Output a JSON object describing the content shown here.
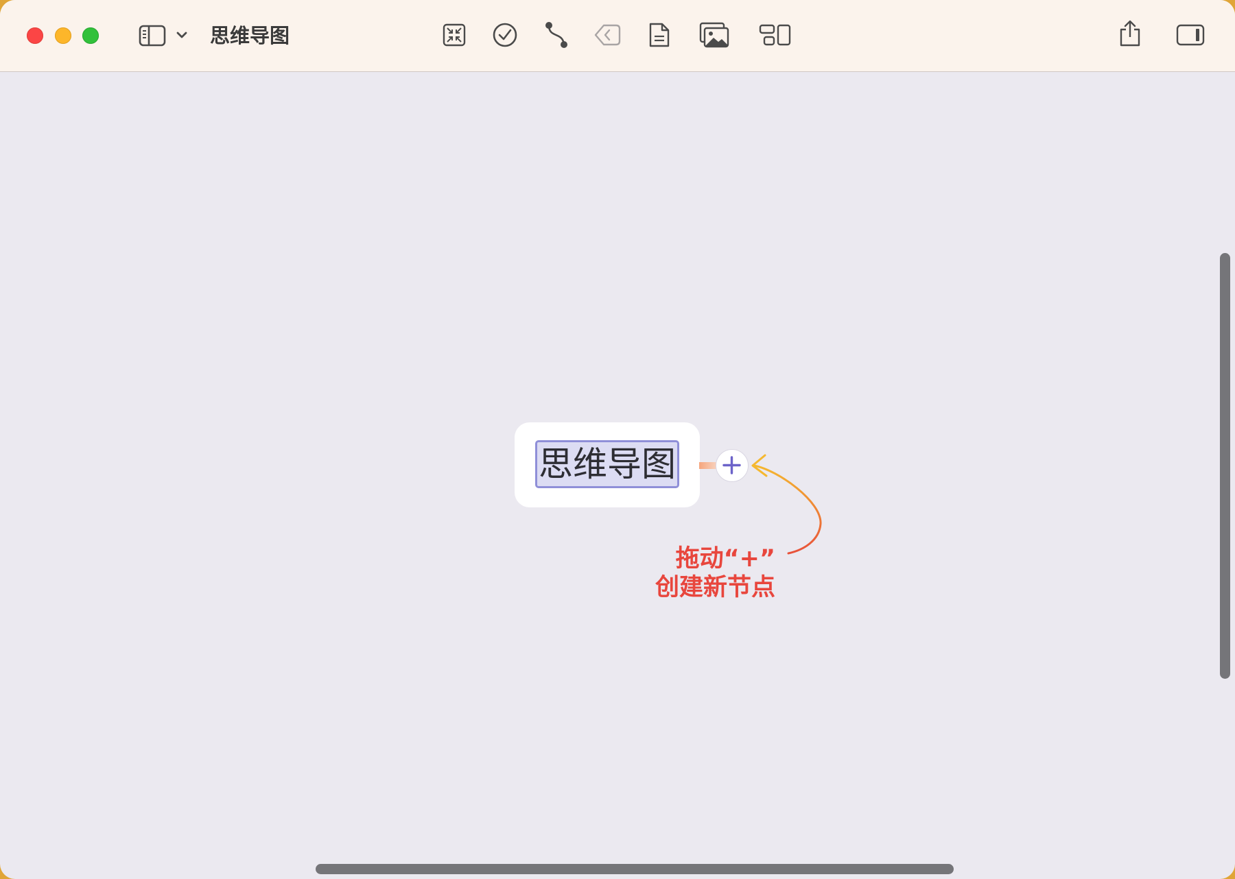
{
  "window": {
    "title": "思维导图",
    "traffic_lights": [
      "close",
      "minimize",
      "zoom"
    ]
  },
  "toolbar": {
    "left_items": [
      "sidebar-toggle-icon",
      "chevron-down-icon"
    ],
    "center_items": [
      "collapse-icon",
      "task-check-icon",
      "relationship-icon",
      "tag-icon",
      "note-icon",
      "image-icon",
      "layout-icon"
    ],
    "right_items": [
      "share-icon",
      "inspector-panel-icon"
    ]
  },
  "mind_map": {
    "central_topic": "思维导图",
    "add_node_symbol": "+"
  },
  "annotation": {
    "line1": "拖动“+”",
    "line2": "创建新节点"
  },
  "colors": {
    "titlebar": "#fbf3ec",
    "canvas": "#ebe9f0",
    "accent": "#6c63c9",
    "annotation_text": "#e8463d",
    "annotation_arrow_start": "#f5b830",
    "annotation_arrow_end": "#e8513a"
  }
}
